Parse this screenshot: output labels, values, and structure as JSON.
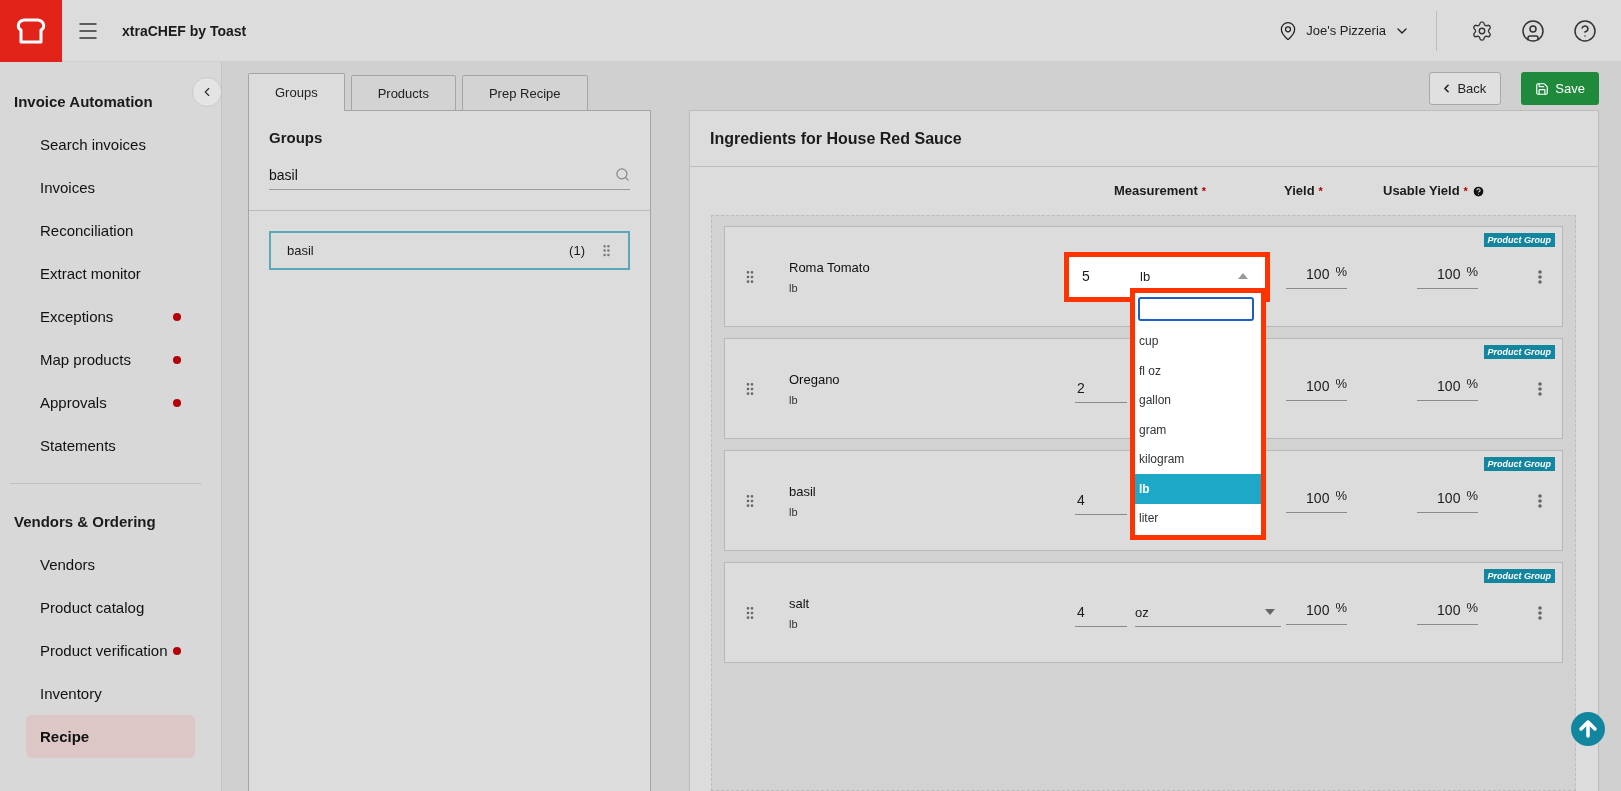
{
  "header": {
    "app_title": "xtraCHEF by Toast",
    "location": "Joe's Pizzeria"
  },
  "sidebar": {
    "sections": [
      {
        "title": "Invoice Automation",
        "items": [
          {
            "label": "Search invoices",
            "dot": false,
            "selected": false
          },
          {
            "label": "Invoices",
            "dot": false,
            "selected": false
          },
          {
            "label": "Reconciliation",
            "dot": false,
            "selected": false
          },
          {
            "label": "Extract monitor",
            "dot": false,
            "selected": false
          },
          {
            "label": "Exceptions",
            "dot": true,
            "selected": false
          },
          {
            "label": "Map products",
            "dot": true,
            "selected": false
          },
          {
            "label": "Approvals",
            "dot": true,
            "selected": false
          },
          {
            "label": "Statements",
            "dot": false,
            "selected": false
          }
        ]
      },
      {
        "title": "Vendors & Ordering",
        "items": [
          {
            "label": "Vendors",
            "dot": false,
            "selected": false
          },
          {
            "label": "Product catalog",
            "dot": false,
            "selected": false
          },
          {
            "label": "Product verification",
            "dot": true,
            "selected": false
          },
          {
            "label": "Inventory",
            "dot": false,
            "selected": false
          },
          {
            "label": "Recipe",
            "dot": false,
            "selected": true
          }
        ]
      }
    ]
  },
  "actions": {
    "back": "Back",
    "save": "Save"
  },
  "tabs": [
    {
      "label": "Groups",
      "selected": true
    },
    {
      "label": "Products",
      "selected": false
    },
    {
      "label": "Prep Recipe",
      "selected": false
    }
  ],
  "groups_panel": {
    "title": "Groups",
    "search": {
      "value": "basil"
    },
    "items": [
      {
        "name": "basil",
        "count": "(1)",
        "selected": true
      }
    ]
  },
  "ingredients_panel": {
    "title": "Ingredients for House Red Sauce",
    "columns": [
      {
        "label": "Measurement",
        "required_mark": "*",
        "help": false
      },
      {
        "label": "Yield",
        "required_mark": "*",
        "help": false
      },
      {
        "label": "Usable Yield",
        "required_mark": "*",
        "help": true
      }
    ],
    "rows": [
      {
        "name": "Roma Tomato",
        "unit": "lb",
        "tag": "Product Group",
        "quantity": "5",
        "measurement": "lb",
        "open": true,
        "highlighted": true,
        "yield": "100",
        "yield_unit": "%",
        "usable_yield": "100",
        "usable_yield_unit": "%"
      },
      {
        "name": "Oregano",
        "unit": "lb",
        "tag": "Product Group",
        "quantity": "2",
        "highlighted": false,
        "yield": "100",
        "yield_unit": "%",
        "usable_yield": "100",
        "usable_yield_unit": "%"
      },
      {
        "name": "basil",
        "unit": "lb",
        "tag": "Product Group",
        "quantity": "4",
        "highlighted": false,
        "yield": "100",
        "yield_unit": "%",
        "usable_yield": "100",
        "usable_yield_unit": "%"
      },
      {
        "name": "salt",
        "unit": "lb",
        "tag": "Product Group",
        "quantity": "4",
        "measurement": "oz",
        "open": false,
        "highlighted": false,
        "yield": "100",
        "yield_unit": "%",
        "usable_yield": "100",
        "usable_yield_unit": "%"
      }
    ],
    "dropdown": {
      "options": [
        {
          "label": "cup",
          "selected": false
        },
        {
          "label": "fl oz",
          "selected": false
        },
        {
          "label": "gallon",
          "selected": false
        },
        {
          "label": "gram",
          "selected": false
        },
        {
          "label": "kilogram",
          "selected": false
        },
        {
          "label": "lb",
          "selected": true
        },
        {
          "label": "liter",
          "selected": false
        }
      ]
    }
  }
}
